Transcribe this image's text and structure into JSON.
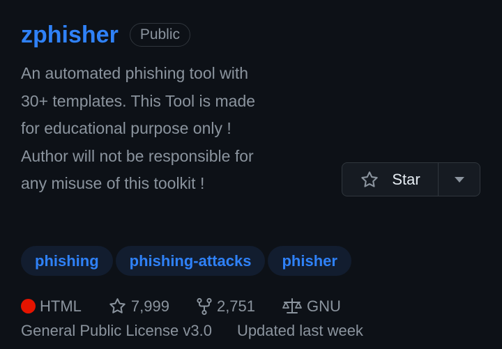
{
  "repo": {
    "name": "zphisher",
    "visibility": "Public",
    "description": "An automated phishing tool with 30+ templates. This Tool is made for educational purpose only ! Author will not be responsible for any misuse of this toolkit !"
  },
  "star_button": {
    "label": "Star",
    "icon": "star-icon",
    "dropdown_icon": "caret-down-icon"
  },
  "topics": [
    "phishing",
    "phishing-attacks",
    "phisher"
  ],
  "meta": {
    "language": "HTML",
    "language_color": "#e51400",
    "stars": "7,999",
    "forks": "2,751",
    "license_line1": "GNU",
    "license_line2": "General Public License v3.0",
    "updated": "Updated last week"
  },
  "colors": {
    "background": "#0d1117",
    "link": "#2f81f7",
    "muted": "#8b949e",
    "topic_bg": "#121d2f"
  }
}
